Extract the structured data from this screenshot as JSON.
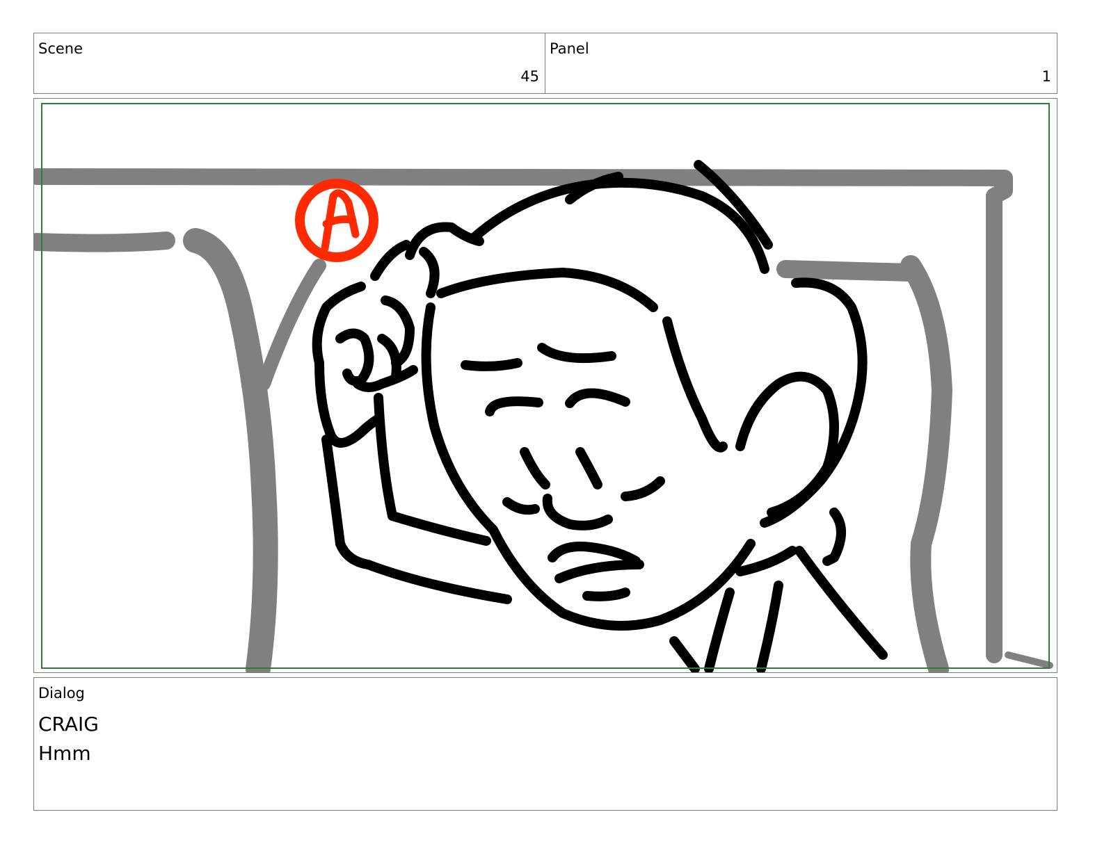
{
  "scene": {
    "label": "Scene",
    "value": "45"
  },
  "panel": {
    "label": "Panel",
    "value": "1"
  },
  "frame": {
    "description_icon": "storyboard-sketch",
    "marker_text": "A",
    "colors": {
      "safe_frame": "#2e7d32",
      "background_lines": "#808080",
      "ink": "#000000",
      "marker": "#ff2a00"
    }
  },
  "dialog": {
    "label": "Dialog",
    "lines": [
      "CRAIG",
      "Hmm"
    ]
  }
}
